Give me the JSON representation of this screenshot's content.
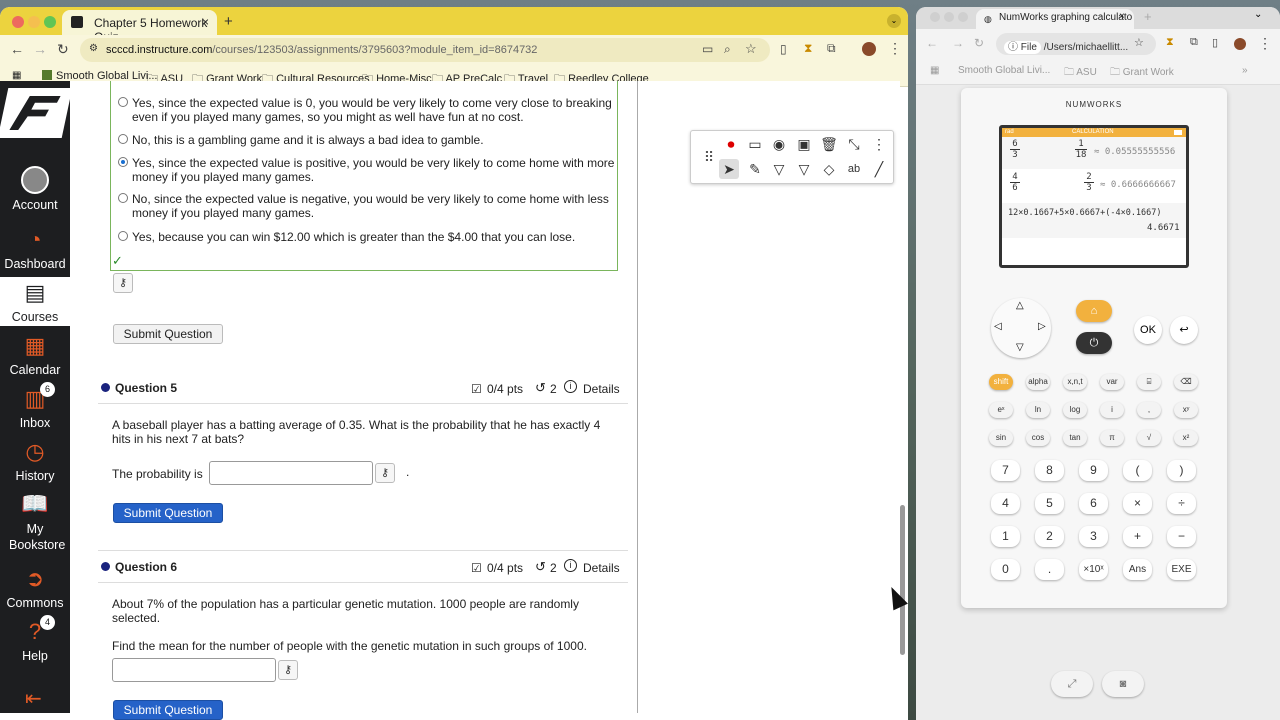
{
  "browser1": {
    "tab_title": "Chapter 5 Homework Quiz",
    "url_domain": "scccd.instructure.com",
    "url_path": "/courses/123503/assignments/3795603?module_item_id=8674732",
    "bookmarks": [
      "Smooth Global Livi...",
      "ASU",
      "Grant Work",
      "Cultural Resources",
      "Home-Misc",
      "AP PreCalc",
      "Travel",
      "Reedley College"
    ]
  },
  "nav": {
    "items": [
      {
        "label": "Account"
      },
      {
        "label": "Dashboard"
      },
      {
        "label": "Courses"
      },
      {
        "label": "Calendar"
      },
      {
        "label": "Inbox",
        "badge": "6"
      },
      {
        "label": "History"
      },
      {
        "label": "My Bookstore"
      },
      {
        "label": "Commons"
      },
      {
        "label": "Help",
        "badge": "4"
      }
    ]
  },
  "q4": {
    "options": [
      "Yes, since the expected value is 0, you would be very likely to come very close to breaking even if you played many games, so you might as well have fun at no cost.",
      "No, this is a gambling game and it is always a bad idea to gamble.",
      "Yes, since the expected value is positive, you would be very likely to come home with more money if you played many games.",
      "No, since the expected value is negative, you would be very likely to come home with less money if you played many games.",
      "Yes, because you can win $12.00 which is greater than the $4.00 that you can lose."
    ],
    "selected": 2,
    "submit": "Submit Question"
  },
  "q5": {
    "title": "Question 5",
    "pts": "0/4 pts",
    "tries": "2",
    "details": "Details",
    "text": "A baseball player has a batting average of 0.35. What is the probability that he has exactly 4 hits in his next 7 at bats?",
    "prompt": "The probability is",
    "period": ".",
    "submit": "Submit Question"
  },
  "q6": {
    "title": "Question 6",
    "pts": "0/4 pts",
    "tries": "2",
    "details": "Details",
    "text": "About 7% of the population has a particular genetic mutation. 1000 people are randomly selected.",
    "text2": "Find the mean for the number of people with the genetic mutation in such groups of 1000.",
    "submit": "Submit Question"
  },
  "browser2": {
    "tab_title": "NumWorks graphing calculato",
    "url": "/Users/michaellitt...",
    "file_label": "File",
    "bookmarks": [
      "Smooth Global Livi...",
      "ASU",
      "Grant Work"
    ]
  },
  "calc": {
    "brand": "NUMWORKS",
    "header_left": "rad",
    "header_title": "CALCULATION",
    "rows": [
      {
        "in_num": "6",
        "in_den": "3",
        "out_num": "1",
        "out_den": "18",
        "approx": "≈ 0.05555555556"
      },
      {
        "in_num": "4",
        "in_den": "6",
        "out_num": "2",
        "out_den": "3",
        "approx": "≈ 0.6666666667"
      }
    ],
    "expr": "12×0.1667+5×0.6667+(-4×0.1667)",
    "result": "4.6671",
    "ok": "OK",
    "keys_row1": [
      "shift",
      "alpha",
      "x,n,t",
      "var",
      "⌸",
      "⌫"
    ],
    "keys_row2": [
      "eˣ",
      "ln",
      "log",
      "i",
      ",",
      "xʸ"
    ],
    "keys_row3": [
      "sin",
      "cos",
      "tan",
      "π",
      "√",
      "x²"
    ],
    "keys_row4": [
      "7",
      "8",
      "9",
      "(",
      ")"
    ],
    "keys_row5": [
      "4",
      "5",
      "6",
      "×",
      "÷"
    ],
    "keys_row6": [
      "1",
      "2",
      "3",
      "+",
      "−"
    ],
    "keys_row7": [
      "0",
      ".",
      "×10ˣ",
      "Ans",
      "EXE"
    ]
  }
}
